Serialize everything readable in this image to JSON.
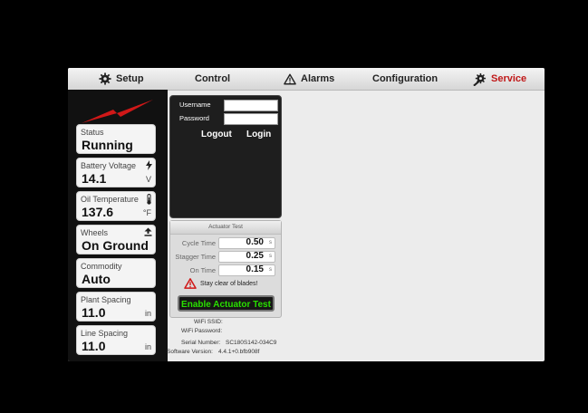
{
  "nav": {
    "tabs": [
      {
        "label": "Setup"
      },
      {
        "label": "Control"
      },
      {
        "label": "Alarms"
      },
      {
        "label": "Configuration"
      },
      {
        "label": "Service"
      }
    ],
    "active_color": "#c01818"
  },
  "sidebar": {
    "cards": [
      {
        "label": "Status",
        "value": "Running",
        "unit": ""
      },
      {
        "label": "Battery Voltage",
        "value": "14.1",
        "unit": "V"
      },
      {
        "label": "Oil Temperature",
        "value": "137.6",
        "unit": "°F"
      },
      {
        "label": "Wheels",
        "value": "On Ground",
        "unit": ""
      },
      {
        "label": "Commodity",
        "value": "Auto",
        "unit": ""
      },
      {
        "label": "Plant Spacing",
        "value": "11.0",
        "unit": "in"
      },
      {
        "label": "Line Spacing",
        "value": "11.0",
        "unit": "in"
      }
    ]
  },
  "login": {
    "username_label": "Username",
    "password_label": "Password",
    "username_value": "",
    "password_value": "",
    "logout_label": "Logout",
    "login_label": "Login"
  },
  "actuator": {
    "title": "Actuator Test",
    "rows": [
      {
        "label": "Cycle Time",
        "value": "0.50",
        "unit": "s"
      },
      {
        "label": "Stagger Time",
        "value": "0.25",
        "unit": "s"
      },
      {
        "label": "On Time",
        "value": "0.15",
        "unit": "s"
      }
    ],
    "warning": "Stay clear of blades!",
    "enable_label": "Enable Actuator Test",
    "enable_color": "#29e000"
  },
  "info": {
    "wifi_ssid_label": "WiFi SSID:",
    "wifi_ssid_value": "",
    "wifi_password_label": "WiFi Password:",
    "wifi_password_value": "",
    "serial_label": "Serial Number:",
    "serial_value": "SC180S142-034C9",
    "software_label": "Software Version:",
    "software_value": "4.4.1+0.bfb908f"
  }
}
